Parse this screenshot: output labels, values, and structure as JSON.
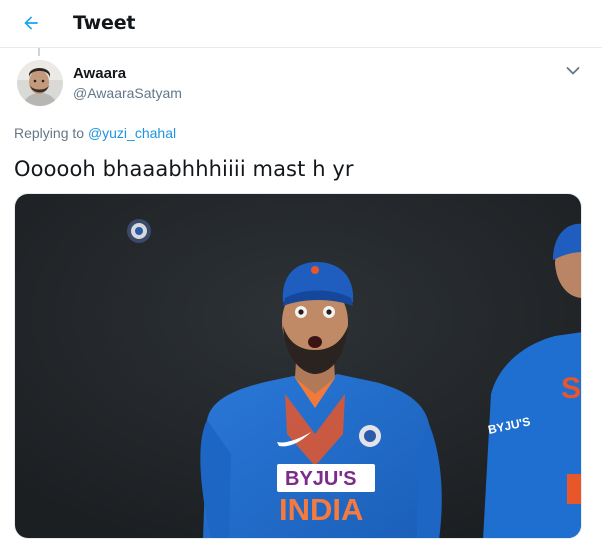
{
  "header": {
    "title": "Tweet",
    "back_icon": "arrow-left-icon"
  },
  "tweet": {
    "author": {
      "display_name": "Awaara",
      "handle": "@AwaaraSatyam"
    },
    "replying_prefix": "Replying to",
    "replying_to": "@yuzi_chahal",
    "text": "Oooooh bhaaabhhhiiii mast h yr",
    "media": {
      "jersey_sponsor": "BYJU'S",
      "jersey_country": "INDIA",
      "sleeve_text": "BYJU'S",
      "partial_jersey_letters": "SH"
    }
  },
  "colors": {
    "accent": "#1da1f2",
    "link": "#1b95e0",
    "secondary_text": "#657786",
    "border": "#e6ecf0",
    "jersey_blue": "#1f6fd0",
    "jersey_orange": "#e8562a"
  }
}
